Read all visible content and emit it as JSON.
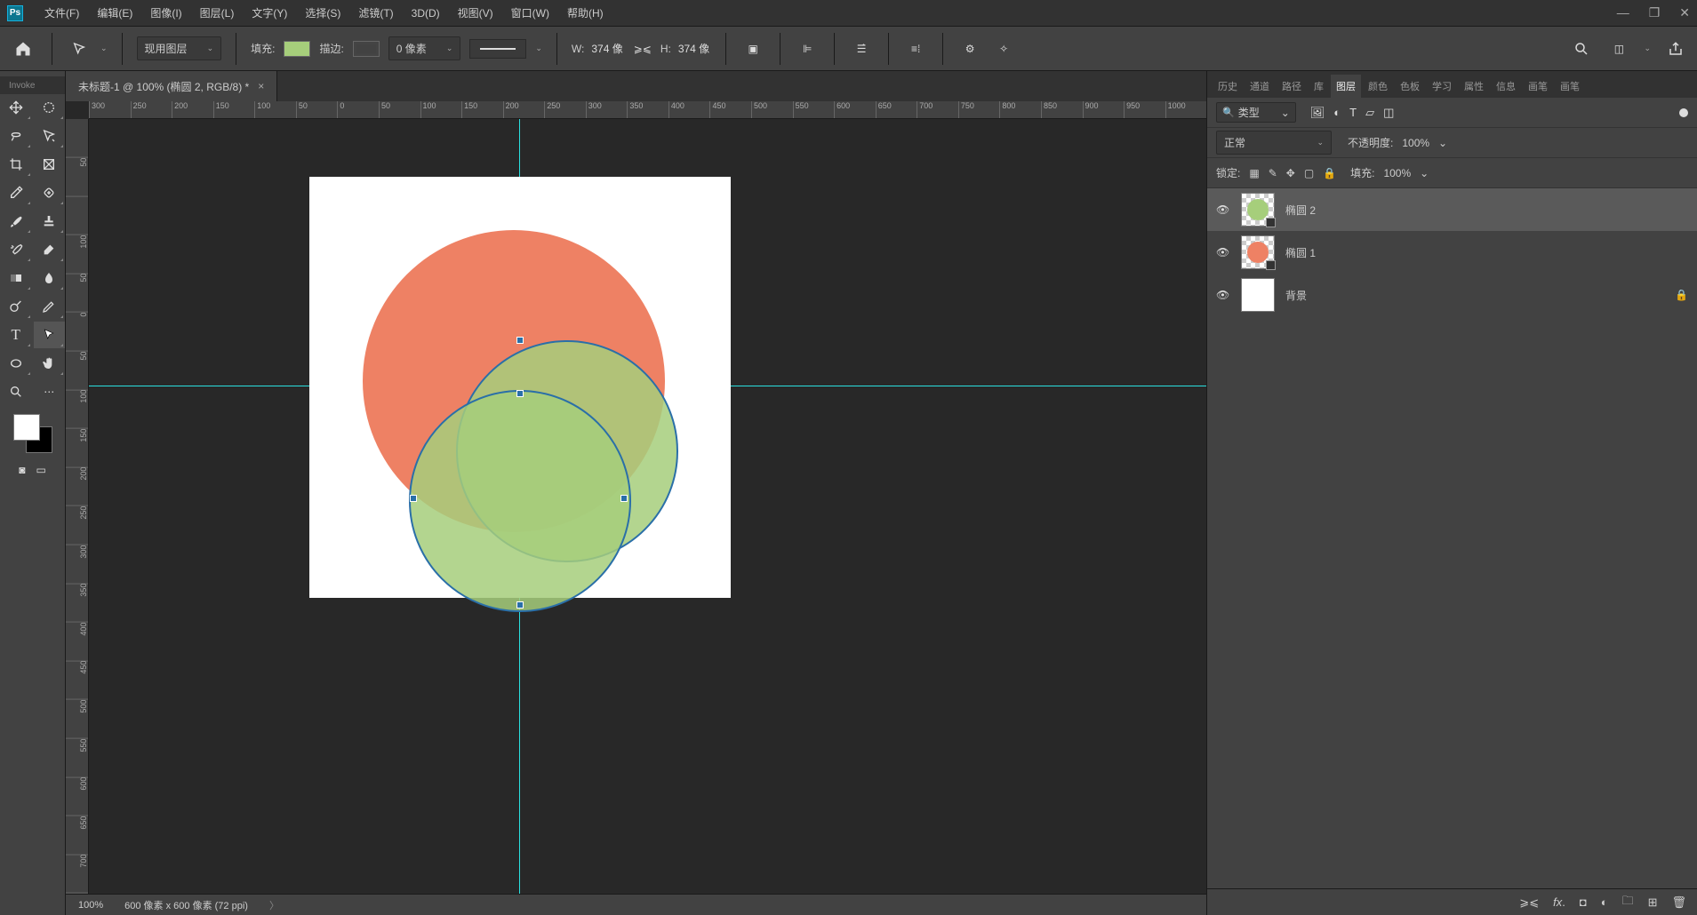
{
  "menubar": {
    "logo": "Ps",
    "items": [
      "文件(F)",
      "编辑(E)",
      "图像(I)",
      "图层(L)",
      "文字(Y)",
      "选择(S)",
      "滤镜(T)",
      "3D(D)",
      "视图(V)",
      "窗口(W)",
      "帮助(H)"
    ]
  },
  "options": {
    "layer_target": "现用图层",
    "fill_label": "填充:",
    "stroke_label": "描边:",
    "stroke_width": "0 像素",
    "w_label": "W:",
    "w_value": "374 像",
    "h_label": "H:",
    "h_value": "374 像"
  },
  "document": {
    "tab_title": "未标题-1 @ 100% (椭圆 2, RGB/8) *",
    "collapsed_tab": "Invoke"
  },
  "ruler_h": [
    "300",
    "250",
    "200",
    "150",
    "100",
    "50",
    "0",
    "50",
    "100",
    "150",
    "200",
    "250",
    "300",
    "350",
    "400",
    "450",
    "500",
    "550",
    "600",
    "650",
    "700",
    "750",
    "800",
    "850",
    "900",
    "950",
    "1000"
  ],
  "ruler_v": [
    "0",
    "5",
    "0",
    "1",
    "5",
    "0",
    "1",
    "0",
    "0",
    "5",
    "0",
    "0",
    "5",
    "0",
    "1",
    "0",
    "0",
    "1",
    "5",
    "0",
    "2",
    "0",
    "0",
    "2",
    "5",
    "0",
    "3",
    "0",
    "0",
    "3",
    "5",
    "0",
    "4",
    "0",
    "0",
    "4",
    "5",
    "0",
    "5",
    "0",
    "0",
    "5",
    "5",
    "0",
    "6",
    "0",
    "0",
    "6",
    "5",
    "0",
    "7"
  ],
  "status": {
    "zoom": "100%",
    "dims": "600 像素 x 600 像素 (72 ppi)"
  },
  "panel_tabs": [
    "历史",
    "通道",
    "路径",
    "库",
    "图层",
    "颜色",
    "色板",
    "学习",
    "属性",
    "信息",
    "画笔",
    "画笔"
  ],
  "panel_active_tab": 4,
  "layer_panel": {
    "kind_label": "类型",
    "blend_mode": "正常",
    "opacity_label": "不透明度:",
    "opacity_value": "100%",
    "lock_label": "锁定:",
    "fill_label": "填充:",
    "fill_value": "100%",
    "layers": [
      {
        "name": "椭圆 2",
        "selected": true,
        "is_shape": true,
        "thumb_color": "#a6ce7b",
        "locked": false
      },
      {
        "name": "椭圆 1",
        "selected": false,
        "is_shape": true,
        "thumb_color": "#ee8164",
        "locked": false
      },
      {
        "name": "背景",
        "selected": false,
        "is_shape": false,
        "thumb_color": "#ffffff",
        "locked": true
      }
    ]
  },
  "colors": {
    "fill": "#a6ce7b",
    "shape1": "#ee8164",
    "shape2": "#a6ce7b",
    "guide": "#2ae0e0",
    "selection": "#2a6fa8"
  }
}
